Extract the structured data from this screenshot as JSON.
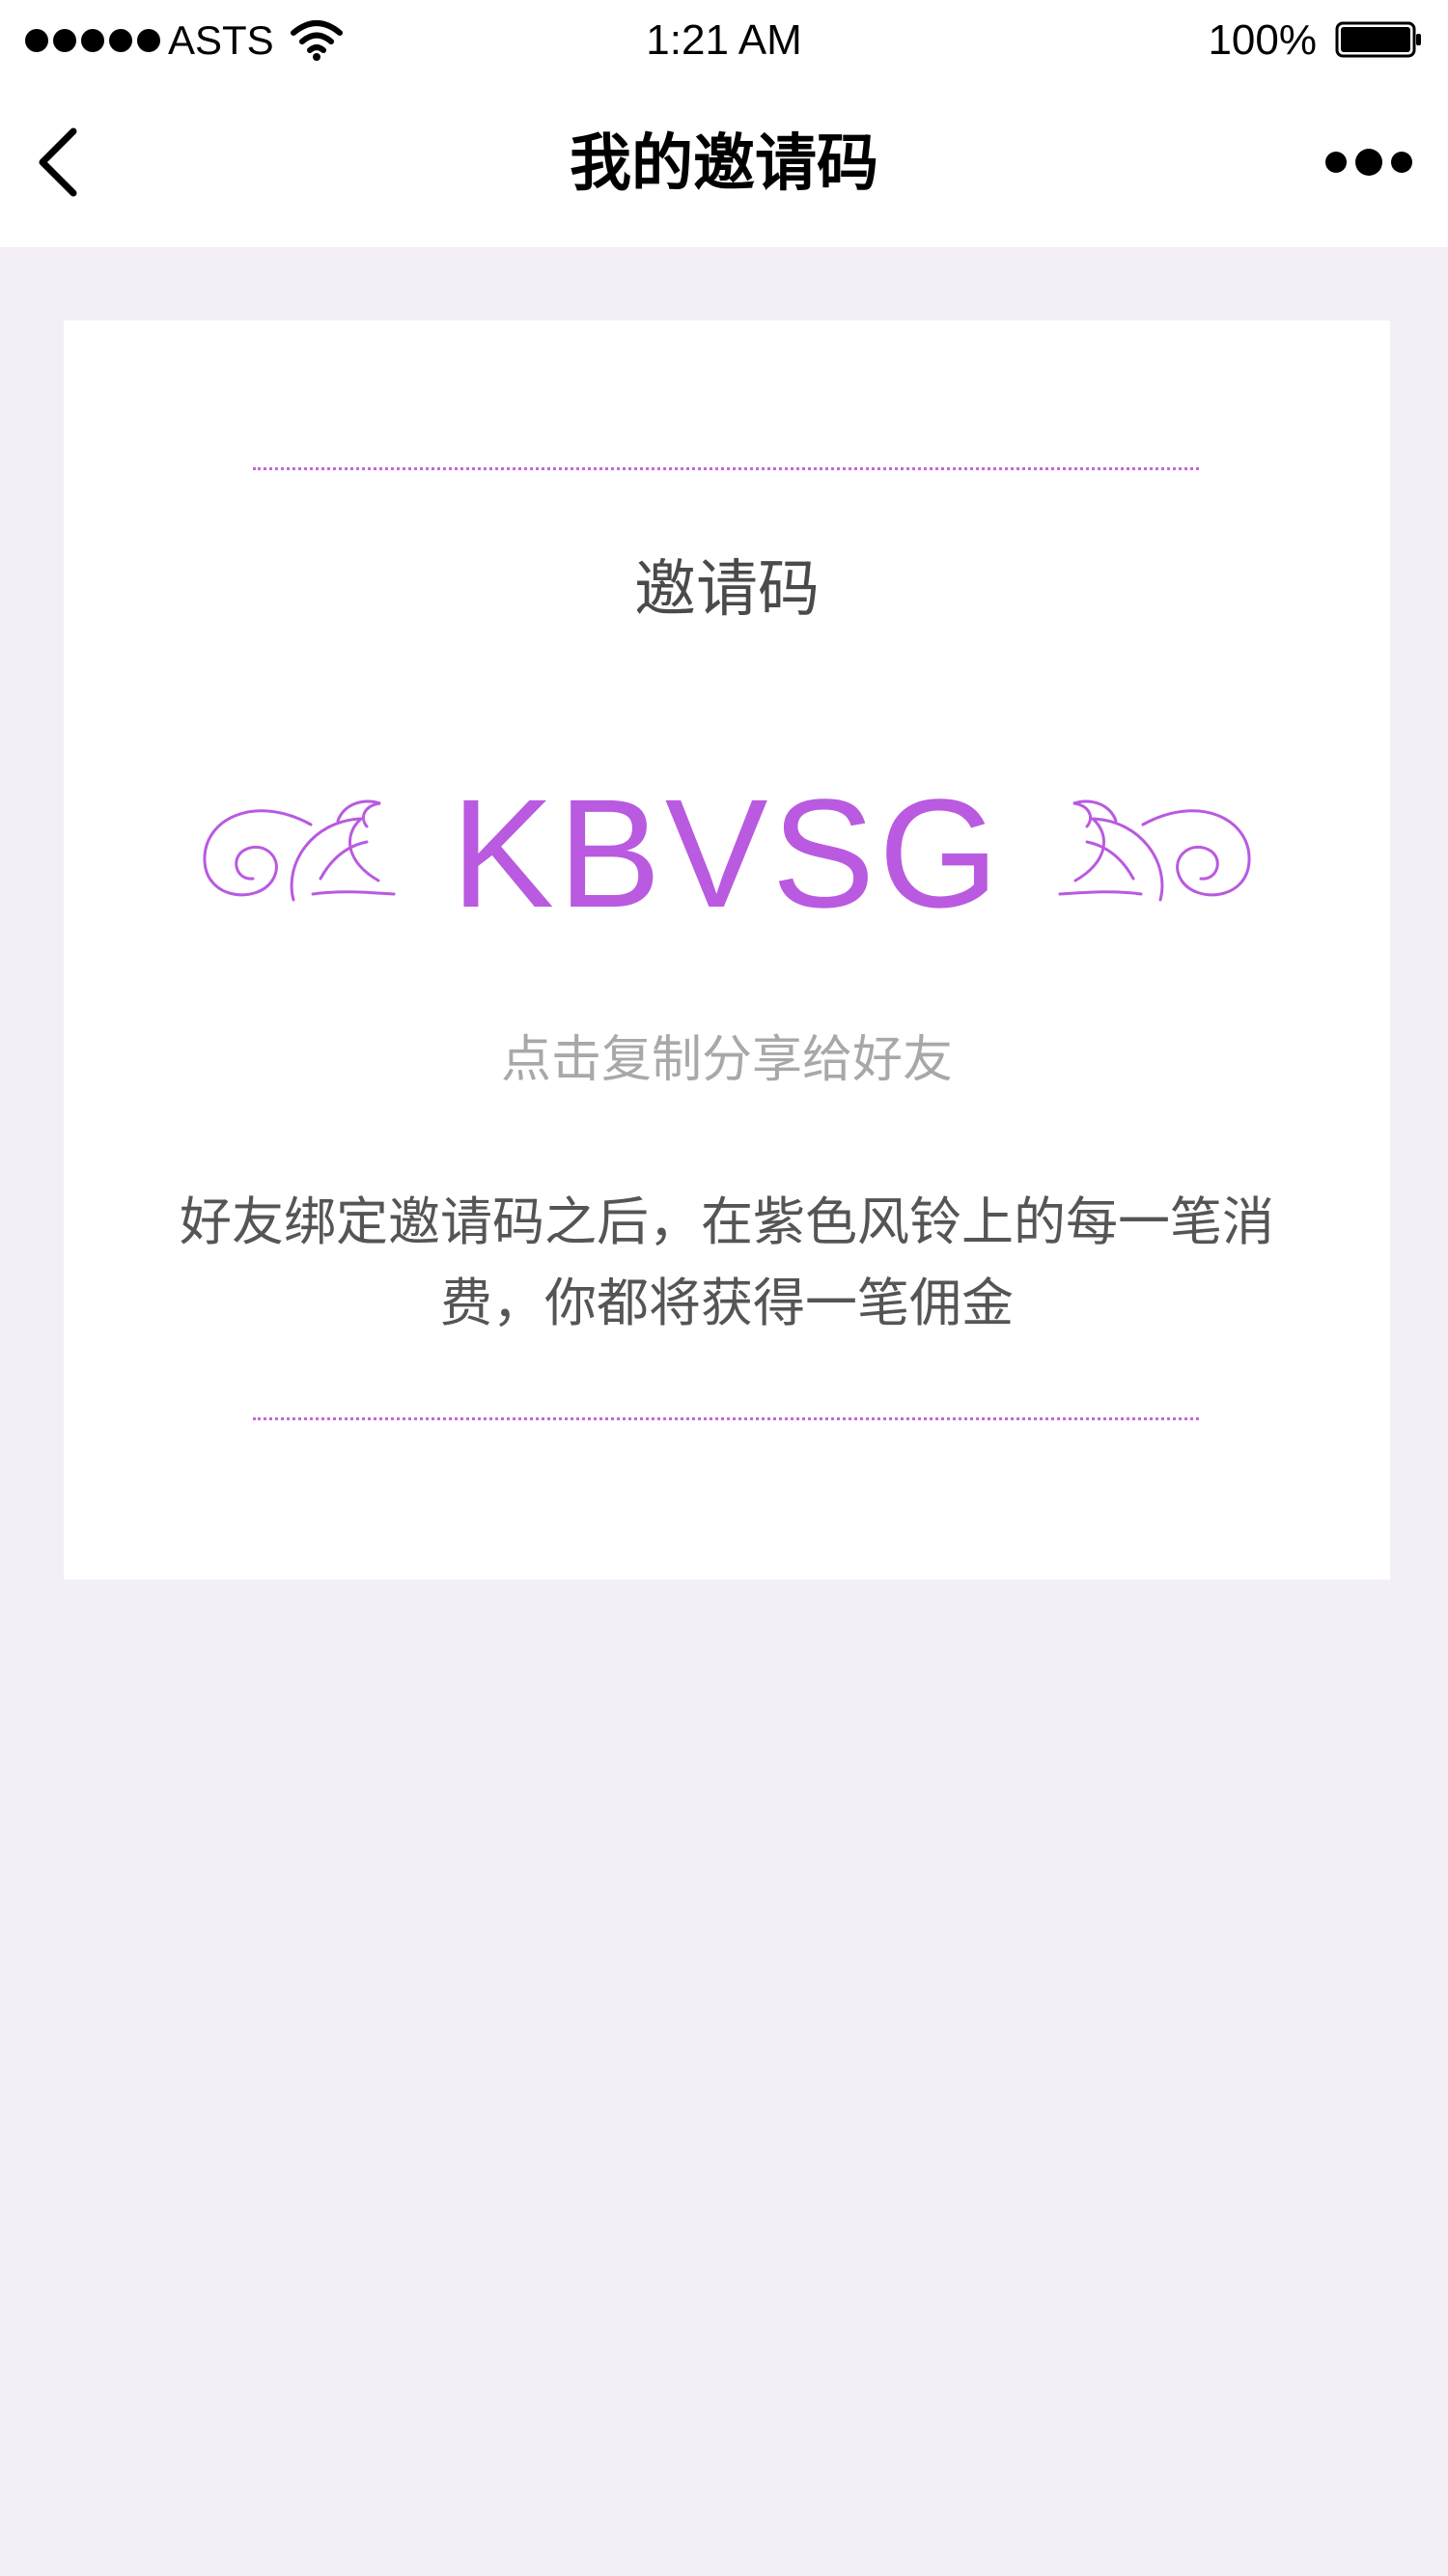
{
  "status_bar": {
    "carrier": "ASTS",
    "time": "1:21 AM",
    "battery_percent": "100%",
    "signal_icon": "signal-dots-icon",
    "wifi_icon": "wifi-icon",
    "battery_icon": "battery-full-icon"
  },
  "nav": {
    "title": "我的邀请码",
    "back_icon": "chevron-left-icon",
    "more_icon": "more-dots-icon"
  },
  "card": {
    "title": "邀请码",
    "invite_code": "KBVSG",
    "copy_hint": "点击复制分享给好友",
    "description": "好友绑定邀请码之后，在紫色风铃上的每一笔消费，你都将获得一笔佣金",
    "flourish_icon": "decorative-flourish-icon"
  },
  "colors": {
    "accent": "#b95ae0",
    "divider": "#c06ad8",
    "page_background": "#f4eff6",
    "card_background": "#ffffff",
    "hint_text": "#a8a8a8",
    "body_text": "#555555"
  }
}
